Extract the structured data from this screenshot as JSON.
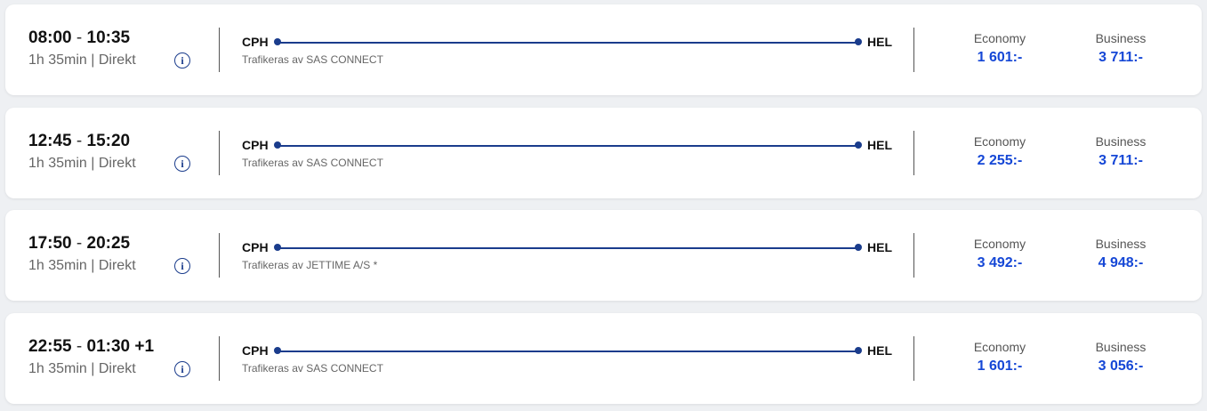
{
  "flights": [
    {
      "depart": "08:00",
      "arrive": "10:35",
      "duration_line": "1h 35min | Direkt",
      "origin": "CPH",
      "destination": "HEL",
      "operator": "Trafikeras av SAS CONNECT",
      "economy_label": "Economy",
      "economy_price": "1 601:-",
      "business_label": "Business",
      "business_price": "3 711:-"
    },
    {
      "depart": "12:45",
      "arrive": "15:20",
      "duration_line": "1h 35min | Direkt",
      "origin": "CPH",
      "destination": "HEL",
      "operator": "Trafikeras av SAS CONNECT",
      "economy_label": "Economy",
      "economy_price": "2 255:-",
      "business_label": "Business",
      "business_price": "3 711:-"
    },
    {
      "depart": "17:50",
      "arrive": "20:25",
      "duration_line": "1h 35min | Direkt",
      "origin": "CPH",
      "destination": "HEL",
      "operator": "Trafikeras av JETTIME A/S *",
      "economy_label": "Economy",
      "economy_price": "3 492:-",
      "business_label": "Business",
      "business_price": "4 948:-"
    },
    {
      "depart": "22:55",
      "arrive": "01:30 +1",
      "duration_line": "1h 35min | Direkt",
      "origin": "CPH",
      "destination": "HEL",
      "operator": "Trafikeras av SAS CONNECT",
      "economy_label": "Economy",
      "economy_price": "1 601:-",
      "business_label": "Business",
      "business_price": "3 056:-"
    }
  ],
  "icons": {
    "info": "info-icon"
  },
  "colors": {
    "route": "#1a3c8c",
    "price": "#1547d6"
  }
}
